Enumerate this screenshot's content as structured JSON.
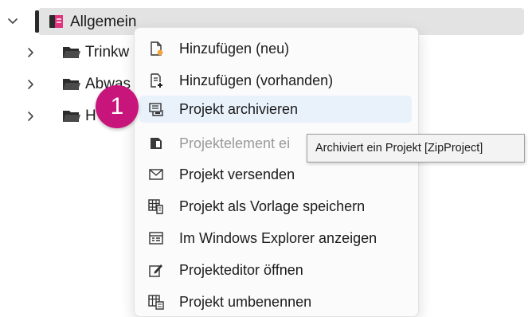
{
  "tree": {
    "root": {
      "label": "Allgemein",
      "chevron_icon": "chevron-down-icon",
      "project_icon": "project-icon",
      "accent_color": "#e0357e"
    },
    "children": [
      {
        "label": "Trinkw",
        "icon": "folder-icon"
      },
      {
        "label": "Abwas",
        "icon": "folder-icon"
      },
      {
        "label": "H",
        "icon": "folder-icon"
      }
    ]
  },
  "context_menu": {
    "items": [
      {
        "label": "Hinzufügen (neu)",
        "icon": "new-file-icon",
        "state": "normal"
      },
      {
        "label": "Hinzufügen (vorhanden)",
        "icon": "add-existing-icon",
        "state": "normal"
      },
      {
        "label": "Projekt archivieren",
        "icon": "archive-icon",
        "state": "highlighted"
      },
      {
        "label": "Projektelement ei",
        "icon": "project-element-icon",
        "state": "disabled"
      },
      {
        "label": "Projekt versenden",
        "icon": "envelope-icon",
        "state": "normal"
      },
      {
        "label": "Projekt als Vorlage speichern",
        "icon": "save-template-icon",
        "state": "normal"
      },
      {
        "label": "Im Windows Explorer anzeigen",
        "icon": "explorer-icon",
        "state": "normal"
      },
      {
        "label": "Projekteditor öffnen",
        "icon": "edit-icon",
        "state": "normal"
      },
      {
        "label": "Projekt umbenennen",
        "icon": "rename-icon",
        "state": "normal"
      }
    ]
  },
  "tooltip": {
    "text": "Archiviert ein Projekt [ZipProject]"
  },
  "step_badge": {
    "number": "1",
    "color": "#c8157c"
  }
}
